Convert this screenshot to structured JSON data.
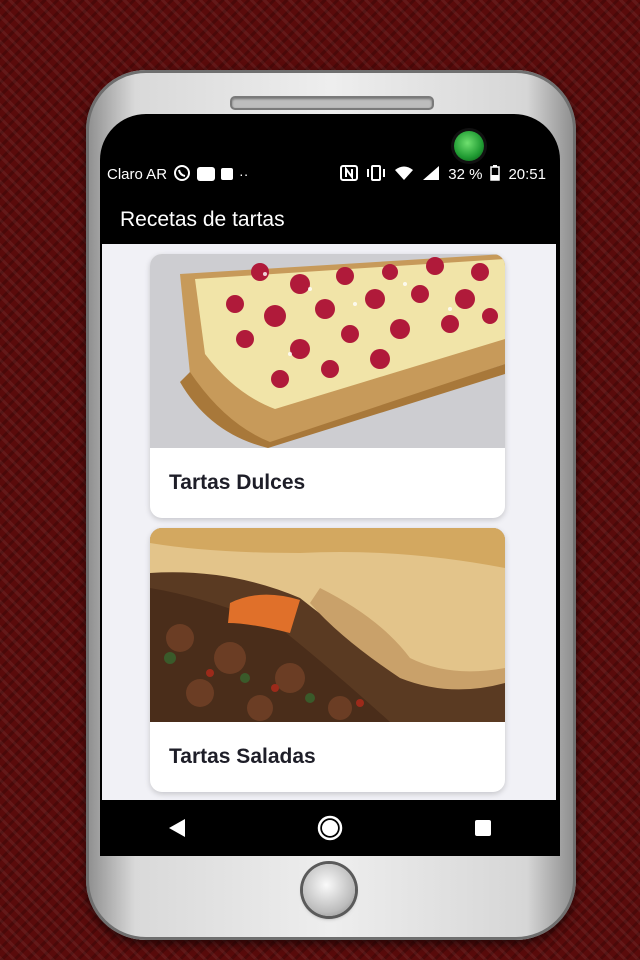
{
  "status_bar": {
    "carrier": "Claro AR",
    "battery": "32 %",
    "time": "20:51",
    "icons": [
      "whatsapp-icon",
      "message-icon",
      "sd-card-icon",
      "more-dots-icon",
      "nfc-icon",
      "vibrate-icon",
      "wifi-icon",
      "signal-icon",
      "battery-icon"
    ]
  },
  "app_bar": {
    "title": "Recetas de tartas"
  },
  "cards": [
    {
      "title": "Tartas Dulces",
      "image": "raspberry-tart-image"
    },
    {
      "title": "Tartas Saladas",
      "image": "meat-pie-image"
    }
  ],
  "nav": {
    "icons": [
      "back-icon",
      "home-icon",
      "recents-icon"
    ]
  }
}
